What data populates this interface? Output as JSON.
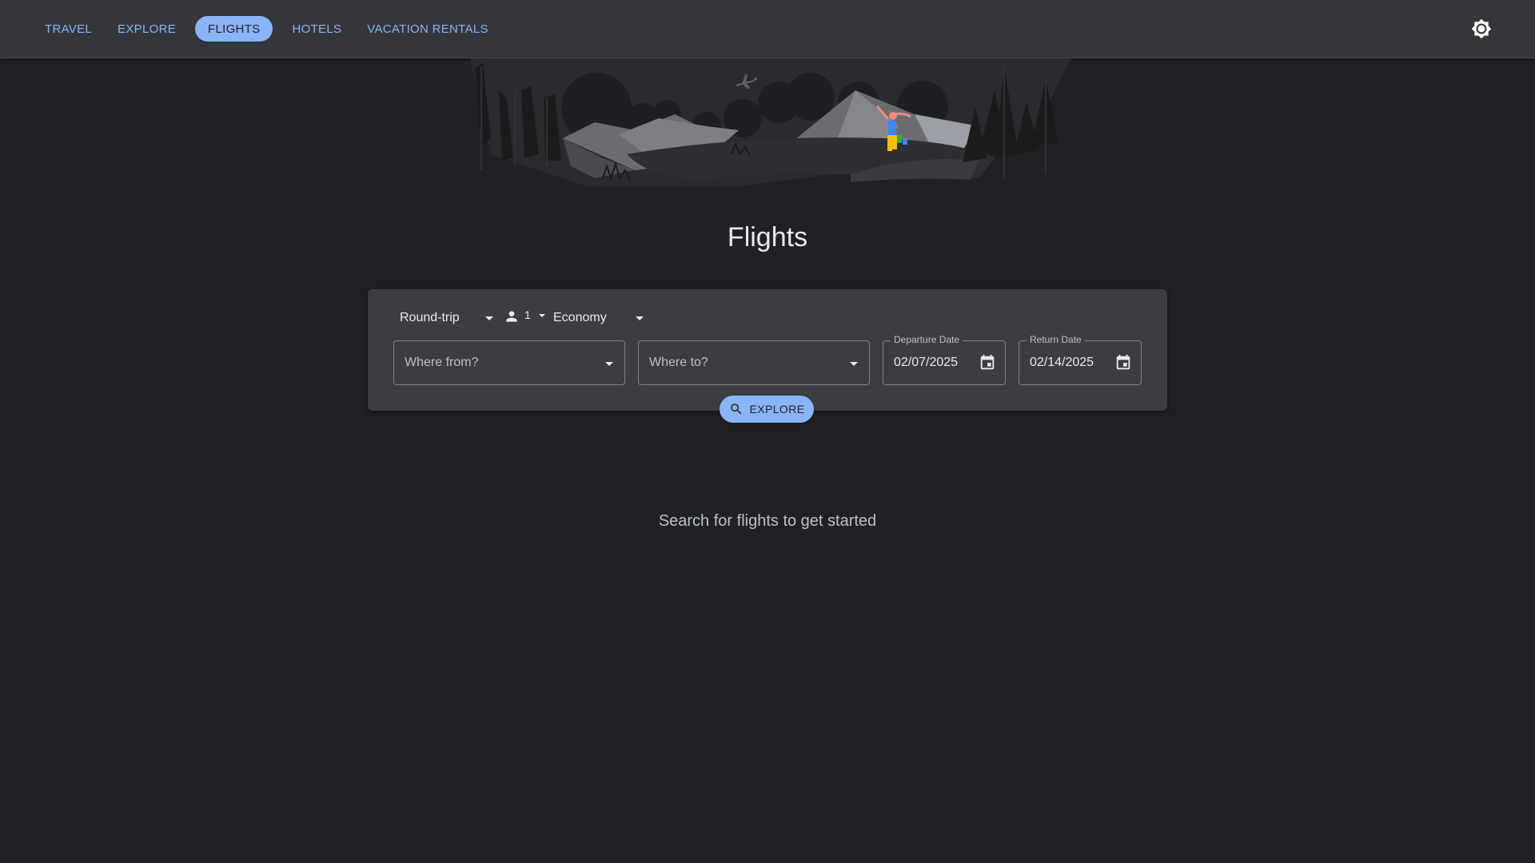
{
  "nav": {
    "items": [
      {
        "label": "TRAVEL"
      },
      {
        "label": "EXPLORE"
      },
      {
        "label": "FLIGHTS",
        "active": true
      },
      {
        "label": "HOTELS"
      },
      {
        "label": "VACATION RENTALS"
      }
    ],
    "theme_toggle_icon": "brightness-icon"
  },
  "hero": {
    "illustration": "mountain-landscape-with-traveler"
  },
  "page": {
    "title": "Flights"
  },
  "search": {
    "trip_type": "Round-trip",
    "passengers": "1",
    "cabin_class": "Economy",
    "from_placeholder": "Where from?",
    "to_placeholder": "Where to?",
    "departure_label": "Departure Date",
    "departure_value": "02/07/2025",
    "return_label": "Return Date",
    "return_value": "02/14/2025",
    "explore_label": "EXPLORE"
  },
  "empty_state": {
    "message": "Search for flights to get started"
  },
  "colors": {
    "background": "#202124",
    "topbar": "#35363a",
    "card": "#3c3d40",
    "accent": "#8ab4f8"
  }
}
